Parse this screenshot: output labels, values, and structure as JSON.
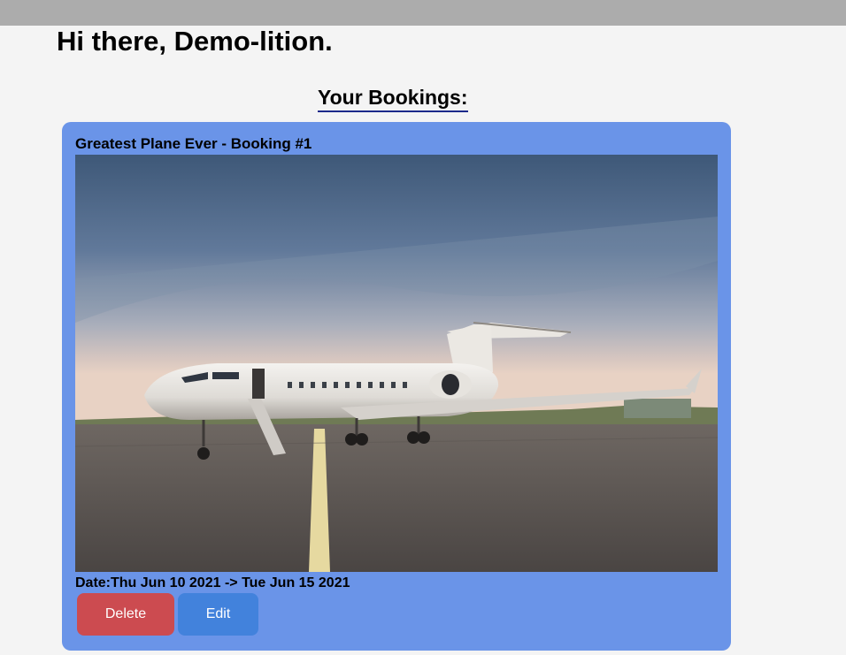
{
  "header": {
    "greeting": "Hi there, Demo-lition."
  },
  "bookings_section": {
    "heading": "Your Bookings:"
  },
  "bookings": [
    {
      "title": "Greatest Plane Ever - Booking #1",
      "date_label": "Date:",
      "date_range": "Thu Jun 10 2021 -> Tue Jun 15 2021",
      "date_full": "Date:Thu Jun 10 2021 -> Tue Jun 15 2021",
      "delete_label": "Delete",
      "edit_label": "Edit"
    }
  ],
  "colors": {
    "top_bar": "#acacac",
    "page_background": "#f4f4f4",
    "card_background": "#6a94e8",
    "heading_underline": "#1c2a8a",
    "delete_button": "#cc4b50",
    "edit_button": "#4282dc"
  }
}
